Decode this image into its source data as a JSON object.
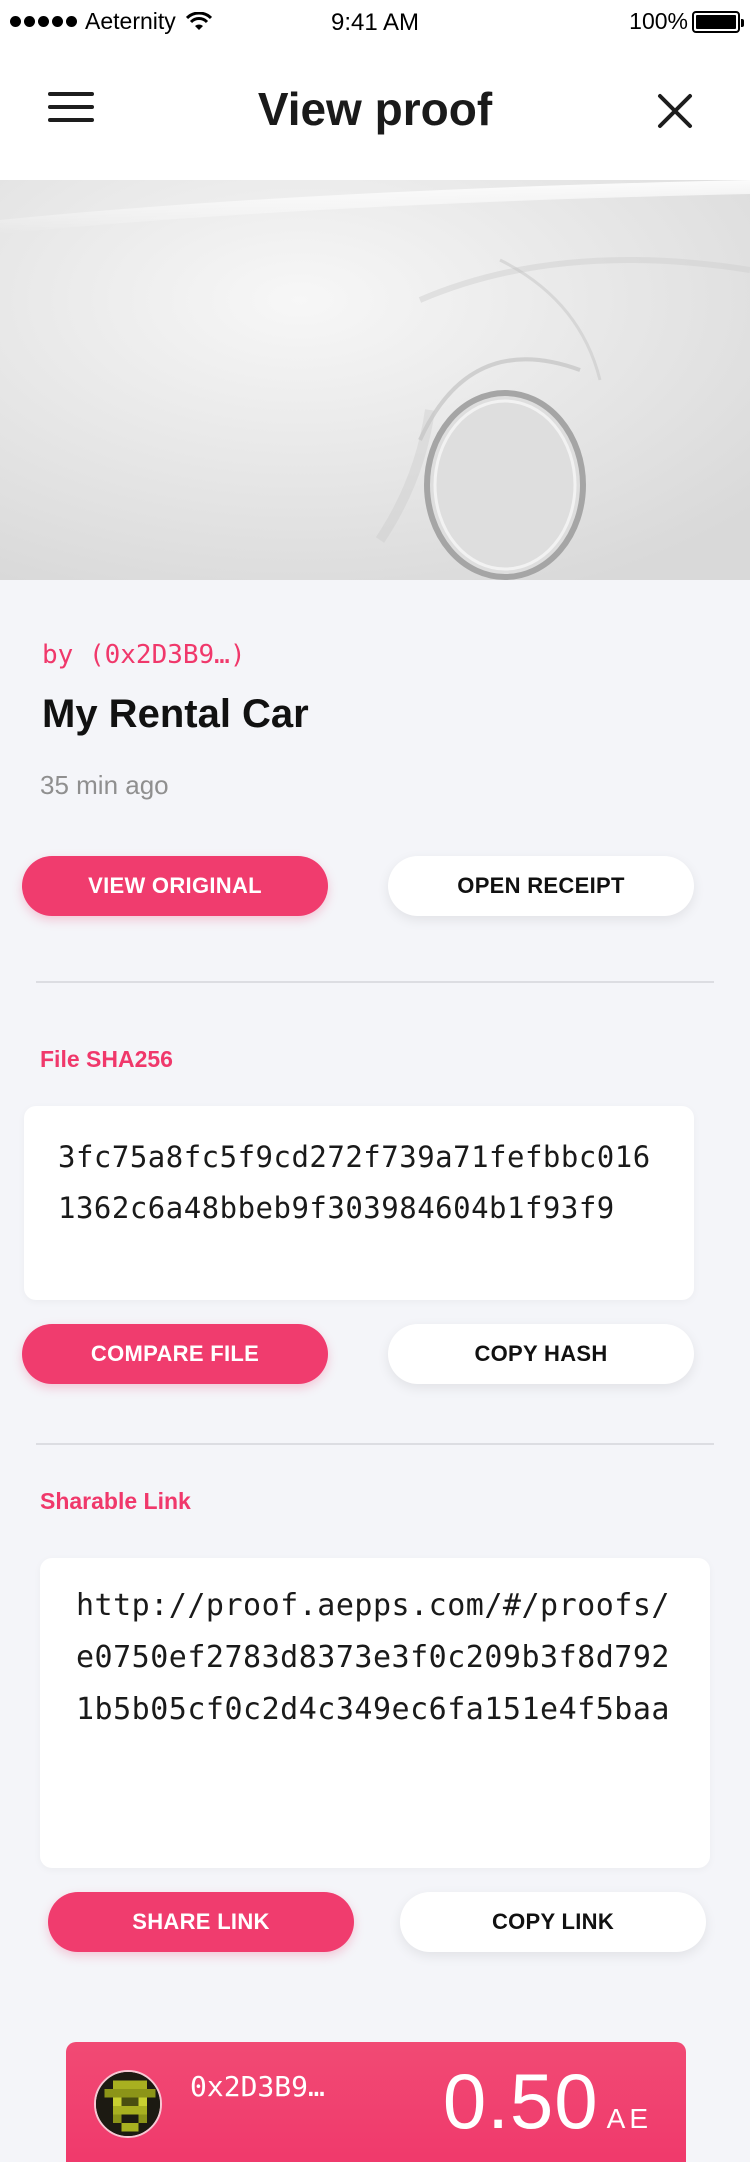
{
  "status_bar": {
    "carrier": "Aeternity",
    "time": "9:41 AM",
    "battery": "100%"
  },
  "navbar": {
    "title": "View proof",
    "menu_icon": "hamburger-menu-icon",
    "close_icon": "close-icon"
  },
  "proof": {
    "author": "by (0x2D3B9…)",
    "title": "My Rental Car",
    "timestamp": "35 min ago",
    "view_original_label": "VIEW ORIGINAL",
    "open_receipt_label": "OPEN RECEIPT"
  },
  "file_hash": {
    "label": "File SHA256",
    "value": "3fc75a8fc5f9cd272f739a71fefbbc0161362c6a48bbeb9f303984604b1f93f9",
    "compare_label": "COMPARE FILE",
    "copy_label": "COPY HASH"
  },
  "share": {
    "label": "Sharable Link",
    "url": "http://proof.aepps.com/#/proofs/e0750ef2783d8373e3f0c209b3f8d7921b5b05cf0c2d4c349ec6fa151e4f5baa",
    "share_label": "SHARE LINK",
    "copy_label": "COPY LINK"
  },
  "wallet": {
    "address": "0x2D3B9…",
    "balance": "0.50",
    "unit": "AE"
  },
  "colors": {
    "accent": "#f03c6e",
    "background": "#f4f5f9",
    "card": "#ffffff"
  }
}
